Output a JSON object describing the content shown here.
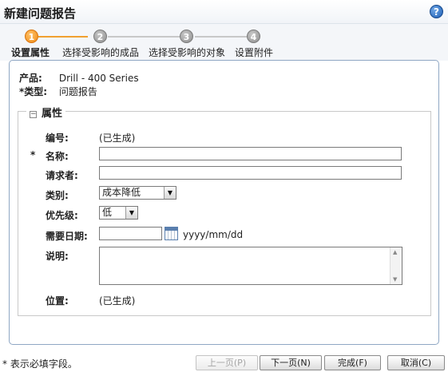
{
  "window": {
    "title": "新建问题报告",
    "help_icon": "help-icon"
  },
  "wizard": {
    "steps": [
      {
        "number": "1",
        "label": "设置属性",
        "state": "active"
      },
      {
        "number": "2",
        "label": "选择受影响的成品",
        "state": "inactive"
      },
      {
        "number": "3",
        "label": "选择受影响的对象",
        "state": "inactive"
      },
      {
        "number": "4",
        "label": "设置附件",
        "state": "inactive"
      }
    ],
    "colors": {
      "active": "#f08a12",
      "inactive": "#8e8e8e"
    }
  },
  "header_info": {
    "product_label": "产品:",
    "product_value": "Drill - 400 Series",
    "type_label": "*类型:",
    "type_value": "问题报告"
  },
  "attributes": {
    "legend": "属性",
    "number": {
      "label": "编号:",
      "value": "(已生成)"
    },
    "name": {
      "required_mark": "*",
      "label": "名称:",
      "value": ""
    },
    "requester": {
      "label": "请求者:",
      "value": ""
    },
    "category": {
      "label": "类别:",
      "selected": "成本降低"
    },
    "priority": {
      "label": "优先级:",
      "selected": "低"
    },
    "need_date": {
      "label": "需要日期:",
      "value": "",
      "format_hint": "yyyy/mm/dd"
    },
    "description": {
      "label": "说明:",
      "value": ""
    },
    "location": {
      "label": "位置:",
      "value": "(已生成)"
    }
  },
  "footer": {
    "required_note": "* 表示必填字段。",
    "buttons": {
      "prev": "上一页(P)",
      "next": "下一页(N)",
      "finish": "完成(F)",
      "cancel": "取消(C)"
    }
  }
}
